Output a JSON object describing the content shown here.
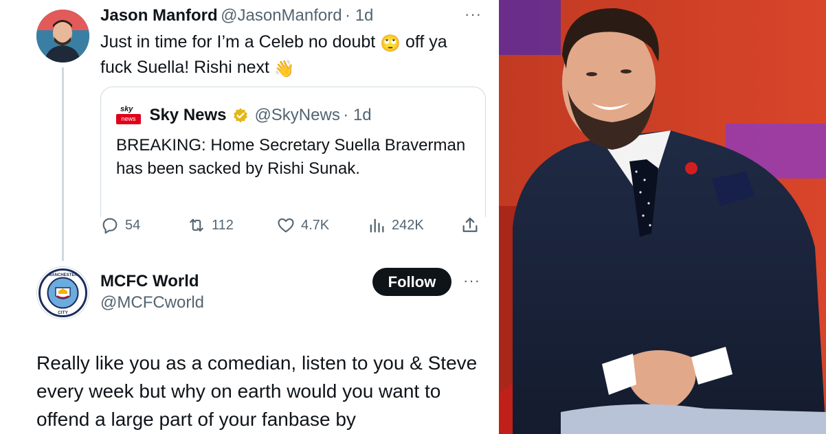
{
  "tweet1": {
    "display_name": "Jason Manford",
    "handle": "@JasonManford",
    "time": "· 1d",
    "text_line1": "Just in time for I’m a Celeb no doubt",
    "emoji1": "🙄",
    "text_line1b": " off ya",
    "text_line2": "fuck Suella! Rishi next",
    "emoji2": "👋",
    "more": "···",
    "quote": {
      "display_name": "Sky News",
      "handle": "@SkyNews",
      "time": "· 1d",
      "logo_top": "sky",
      "logo_bottom": "news",
      "text": "BREAKING: Home Secretary Suella Braverman has been sacked by Rishi Sunak."
    },
    "stats": {
      "replies": "54",
      "retweets": "112",
      "likes": "4.7K",
      "views": "242K"
    }
  },
  "tweet2": {
    "display_name": "MCFC World",
    "handle": "@MCFCworld",
    "follow_label": "Follow",
    "more": "···",
    "badge_text_top": "MANCHESTER",
    "badge_text_bottom": "CITY",
    "text": "Really like you as a comedian, listen to you & Steve every week but why on earth would you want to offend a large part of your fanbase by"
  },
  "colors": {
    "text": "#0f1419",
    "muted": "#536471",
    "border": "#cfd9de",
    "follow_bg": "#0f1419",
    "sky_red": "#e0001a",
    "verified_gold": "#e2b719"
  }
}
